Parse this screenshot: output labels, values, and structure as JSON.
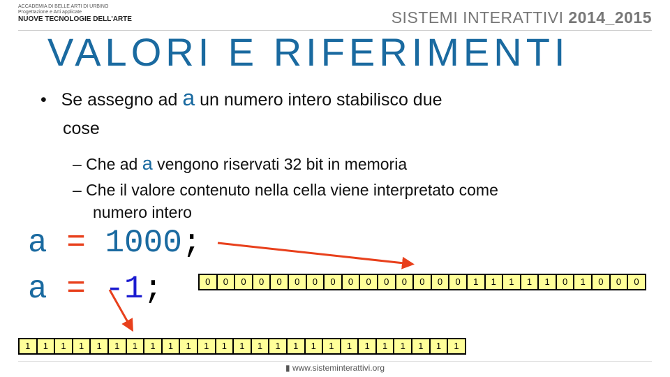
{
  "header": {
    "line1": "ACCADEMIA DI BELLE ARTI DI URBINO",
    "line2": "Progettazione e Arti applicate",
    "line3": "NUOVE TECNOLOGIE DELL'ARTE",
    "course": "SISTEMI INTERATTIVI",
    "year": "2014_2015"
  },
  "title": "VALORI E RIFERIMENTI",
  "bullet": {
    "pre": "Se assegno ad",
    "var": "a",
    "post": "un numero intero stabilisco due",
    "cont": "cose"
  },
  "subs": [
    {
      "pre": "– Che ad",
      "var": "a",
      "post": "vengono riservati 32 bit in memoria"
    },
    {
      "text": "– Che il valore contenuto nella cella viene interpretato come",
      "cont": "numero intero"
    }
  ],
  "code": [
    {
      "var": "a",
      "op": "=",
      "val": "1000",
      "end": ";"
    },
    {
      "var": "a",
      "op": "=",
      "val": "-1",
      "end": ";"
    }
  ],
  "bits_1000": [
    "0",
    "0",
    "0",
    "0",
    "0",
    "0",
    "0",
    "0",
    "0",
    "0",
    "0",
    "0",
    "0",
    "0",
    "0",
    "1",
    "1",
    "1",
    "1",
    "1",
    "0",
    "1",
    "0",
    "0",
    "0"
  ],
  "bits_minus1": [
    "1",
    "1",
    "1",
    "1",
    "1",
    "1",
    "1",
    "1",
    "1",
    "1",
    "1",
    "1",
    "1",
    "1",
    "1",
    "1",
    "1",
    "1",
    "1",
    "1",
    "1",
    "1",
    "1",
    "1",
    "1"
  ],
  "footer": "www.sisteminterattivi.org",
  "colors": {
    "title": "#1a6aa0",
    "op": "#e8401c",
    "num": "#1b1bd0",
    "cell": "#ffff99",
    "arrow": "#e8401c"
  }
}
